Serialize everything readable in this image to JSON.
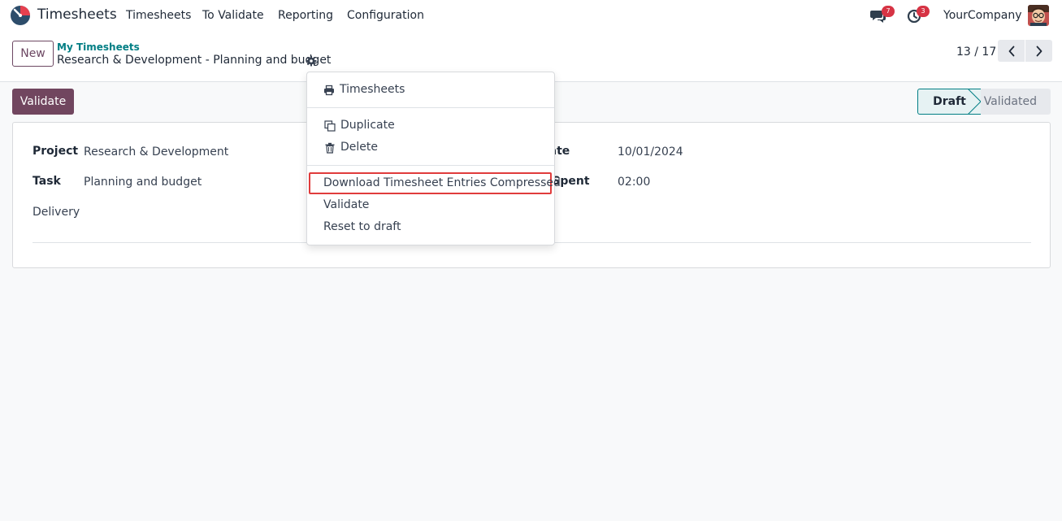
{
  "navbar": {
    "app_name": "Timesheets",
    "menu": [
      "Timesheets",
      "To Validate",
      "Reporting",
      "Configuration"
    ],
    "messages_count": "7",
    "activities_count": "3",
    "company": "YourCompany"
  },
  "control": {
    "new_label": "New",
    "breadcrumb_parent": "My Timesheets",
    "breadcrumb_current": "Research & Development - Planning and budget",
    "pager": "13 / 17"
  },
  "statusbar": {
    "validate_label": "Validate",
    "states": [
      "Draft",
      "Validated"
    ],
    "active_state": "Draft"
  },
  "form": {
    "project_label": "Project",
    "project_value": "Research & Development",
    "task_label": "Task",
    "task_value": "Planning and budget",
    "delivery_label": "Delivery",
    "date_label": "Date",
    "date_value": "10/01/2024",
    "time_label": "Time Spent",
    "time_value": "02:00"
  },
  "menu_dropdown": {
    "print_label": "Timesheets",
    "duplicate_label": "Duplicate",
    "delete_label": "Delete",
    "download_label": "Download Timesheet Entries Compressed",
    "validate_label": "Validate",
    "reset_label": "Reset to draft"
  },
  "colors": {
    "primary": "#71465f",
    "teal": "#017e84",
    "badge": "#d63344",
    "highlight": "#e03c3c"
  }
}
